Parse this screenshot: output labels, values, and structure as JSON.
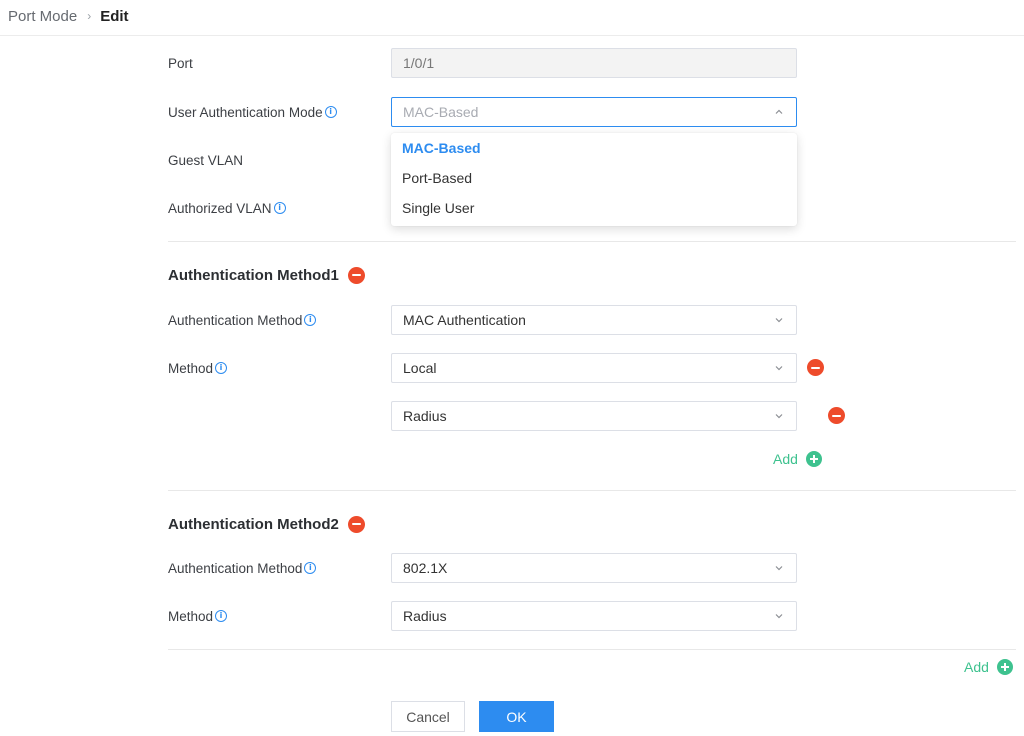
{
  "breadcrumb": {
    "parent": "Port Mode",
    "separator": "›",
    "current": "Edit"
  },
  "form": {
    "port": {
      "label": "Port",
      "value": "1/0/1"
    },
    "user_auth_mode": {
      "label": "User Authentication Mode",
      "value": "MAC-Based",
      "options": [
        "MAC-Based",
        "Port-Based",
        "Single User"
      ],
      "selected_index": 0
    },
    "guest_vlan": {
      "label": "Guest VLAN"
    },
    "authorized_vlan": {
      "label": "Authorized VLAN"
    }
  },
  "method1": {
    "title": "Authentication Method1",
    "auth_method_label": "Authentication Method",
    "auth_method_value": "MAC Authentication",
    "method_label": "Method",
    "methods": [
      "Local",
      "Radius"
    ],
    "add_label": "Add"
  },
  "method2": {
    "title": "Authentication Method2",
    "auth_method_label": "Authentication Method",
    "auth_method_value": "802.1X",
    "method_label": "Method",
    "methods": [
      "Radius"
    ]
  },
  "add_label": "Add",
  "buttons": {
    "cancel": "Cancel",
    "ok": "OK"
  },
  "colors": {
    "accent": "#2d8cf0",
    "danger": "#ee4b2b",
    "success": "#3ec28f"
  },
  "icons": {
    "info": "info-circle-icon",
    "remove": "minus-circle-icon",
    "add": "plus-circle-icon",
    "dropdown": "chevron-down-icon"
  }
}
